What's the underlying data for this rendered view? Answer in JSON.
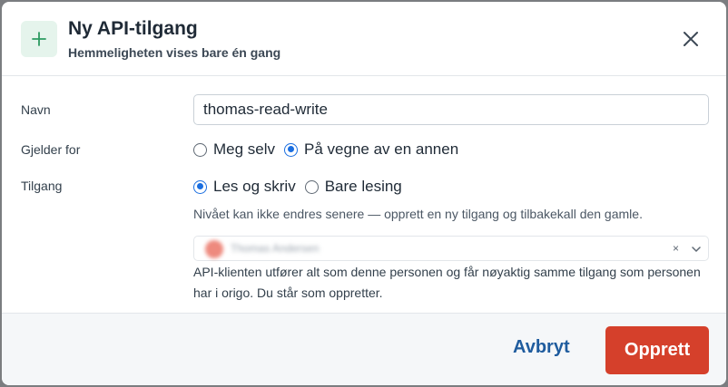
{
  "dialog": {
    "title": "Ny API-tilgang",
    "subtitle": "Hemmeligheten vises bare én gang",
    "icon": "plus-icon",
    "close_icon": "close-icon"
  },
  "form": {
    "name_label": "Navn",
    "name_value": "thomas-read-write",
    "applies_label": "Gjelder for",
    "applies_options": [
      {
        "label": "Meg selv",
        "checked": false
      },
      {
        "label": "På vegne av en annen",
        "checked": true
      }
    ],
    "access_label": "Tilgang",
    "access_options": [
      {
        "label": "Les og skriv",
        "checked": true
      },
      {
        "label": "Bare lesing",
        "checked": false
      }
    ],
    "access_hint": "Nivået kan ikke endres senere — opprett en ny tilgang og tilbakekall den gamle.",
    "person_select": {
      "clear_symbol": "×",
      "chevron_icon": "chevron-down-icon"
    },
    "description": "API-klienten utfører alt som denne personen og får nøyaktig samme tilgang som personen har i origo. Du står som oppretter."
  },
  "footer": {
    "cancel_label": "Avbryt",
    "create_label": "Opprett"
  },
  "colors": {
    "primary": "#d5402b",
    "link": "#1f5c9e",
    "radio_selected": "#1a6ee0",
    "icon_bg": "#e5f4ec",
    "icon_fg": "#2c9a61"
  }
}
